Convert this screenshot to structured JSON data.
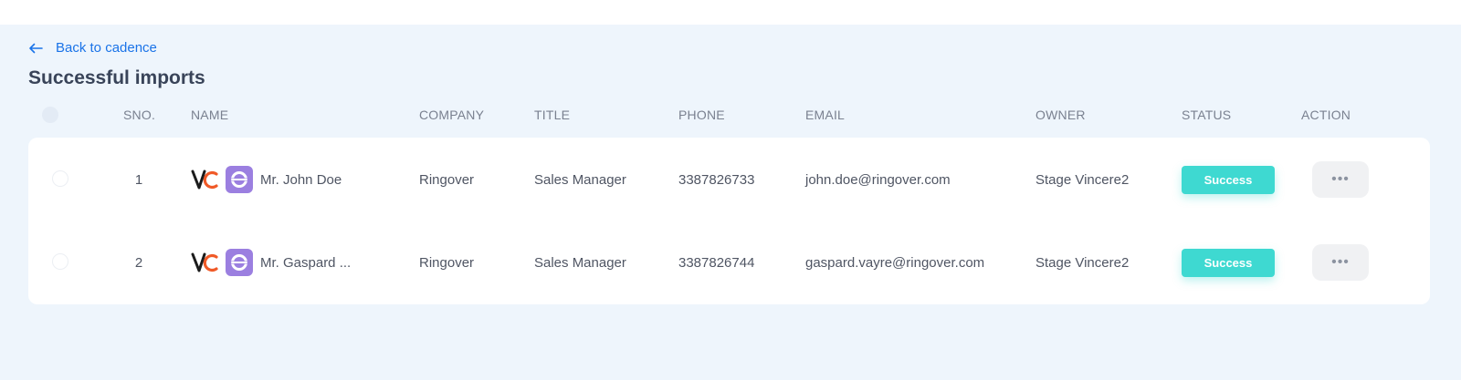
{
  "header": {
    "back_label": "Back to cadence",
    "title": "Successful imports"
  },
  "table": {
    "columns": {
      "sno": "SNO.",
      "name": "NAME",
      "company": "COMPANY",
      "title": "TITLE",
      "phone": "PHONE",
      "email": "EMAIL",
      "owner": "OWNER",
      "status": "STATUS",
      "action": "ACTION"
    },
    "rows": [
      {
        "sno": "1",
        "name": "Mr. John Doe",
        "company": "Ringover",
        "title": "Sales Manager",
        "phone": "3387826733",
        "email": "john.doe@ringover.com",
        "owner": "Stage Vincere2",
        "status": "Success",
        "action": "•••"
      },
      {
        "sno": "2",
        "name": "Mr. Gaspard ...",
        "company": "Ringover",
        "title": "Sales Manager",
        "phone": "3387826744",
        "email": "gaspard.vayre@ringover.com",
        "owner": "Stage Vincere2",
        "status": "Success",
        "action": "•••"
      }
    ]
  },
  "colors": {
    "accent": "#1a73e8",
    "success": "#3ed9d1",
    "page_bg": "#eef5fc",
    "integration_purple": "#9b7fe0"
  },
  "icons": [
    "back-arrow-icon",
    "vc-logo-icon",
    "ringover-icon",
    "more-icon"
  ]
}
